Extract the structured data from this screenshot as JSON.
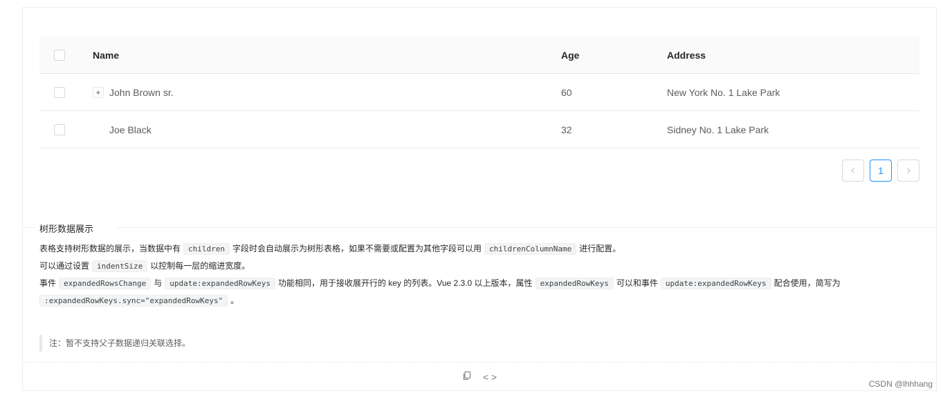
{
  "table": {
    "headers": {
      "name": "Name",
      "age": "Age",
      "address": "Address"
    },
    "rows": [
      {
        "expand": "+",
        "name": "John Brown sr.",
        "age": "60",
        "address": "New York No. 1 Lake Park"
      },
      {
        "name": "Joe Black",
        "age": "32",
        "address": "Sidney No. 1 Lake Park"
      }
    ]
  },
  "pagination": {
    "prev": "<",
    "current": "1",
    "next": ">"
  },
  "description": {
    "title": "树形数据展示",
    "line1": {
      "a": "表格支持树形数据的展示，当数据中有",
      "code1": "children",
      "b": "字段时会自动展示为树形表格，如果不需要或配置为其他字段可以用",
      "code2": "childrenColumnName",
      "c": "进行配置。"
    },
    "line2": {
      "a": "可以通过设置",
      "code1": "indentSize",
      "b": "以控制每一层的缩进宽度。"
    },
    "line3": {
      "a": "事件",
      "code1": "expandedRowsChange",
      "b": "与",
      "code2": "update:expandedRowKeys",
      "c": "功能相同，用于接收展开行的 key 的列表。Vue 2.3.0 以上版本，属性",
      "code3": "expandedRowKeys",
      "d": "可以和事件",
      "code4": "update:expandedRowKeys",
      "e": "配合使用，简写为"
    },
    "line4": {
      "code1": ":expandedRowKeys.sync=\"expandedRowKeys\"",
      "a": "。"
    },
    "note": "注：暂不支持父子数据递归关联选择。"
  },
  "actions": {
    "copy_icon": "copy-icon",
    "code_icon": "code-icon",
    "code_glyph": "< >"
  },
  "watermark": "CSDN @lhhhang",
  "colors": {
    "accent": "#1890ff",
    "border": "#e8e8e8",
    "header_bg": "#fafafa"
  }
}
